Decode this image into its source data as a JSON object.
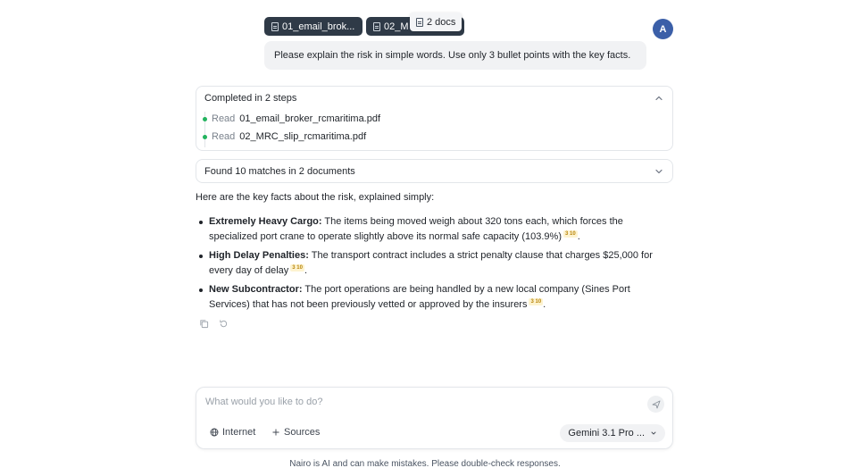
{
  "attachments": [
    {
      "label": "01_email_brok..."
    },
    {
      "label": "02_M"
    }
  ],
  "tooltip": {
    "label": "2 docs"
  },
  "avatar": {
    "initial": "A",
    "color": "#3b5fa8"
  },
  "user_message": "Please explain the risk in simple words. Use only 3 bullet points with the key facts.",
  "steps": {
    "header": "Completed in 2 steps",
    "items": [
      {
        "verb": "Read",
        "file": "01_email_broker_rcmaritima.pdf"
      },
      {
        "verb": "Read",
        "file": "02_MRC_slip_rcmaritima.pdf"
      }
    ]
  },
  "matches": {
    "label": "Found 10 matches in 2 documents"
  },
  "response": {
    "intro": "Here are the key facts about the risk, explained simply:",
    "bullets": [
      {
        "title": "Extremely Heavy Cargo:",
        "text": " The items being moved weigh about 320 tons each, which forces the specialized port crane to operate slightly above its normal safe capacity (103.9%)",
        "citation": "3 10"
      },
      {
        "title": "High Delay Penalties:",
        "text": " The transport contract includes a strict penalty clause that charges $25,000 for every day of delay",
        "citation": "3 10"
      },
      {
        "title": "New Subcontractor:",
        "text": " The port operations are being handled by a new local company (Sines Port Services) that has not been previously vetted or approved by the insurers",
        "citation": "3 10"
      }
    ]
  },
  "composer": {
    "placeholder": "What would you like to do?",
    "internet_label": "Internet",
    "sources_label": "Sources",
    "model_label": "Gemini 3.1 Pro ..."
  },
  "disclaimer": "Nairo is AI and can make mistakes. Please double-check responses.",
  "colors": {
    "status_dot": "#22b35e",
    "citation_bg": "#fdf3d0",
    "chip_bg": "#2f3a47"
  }
}
